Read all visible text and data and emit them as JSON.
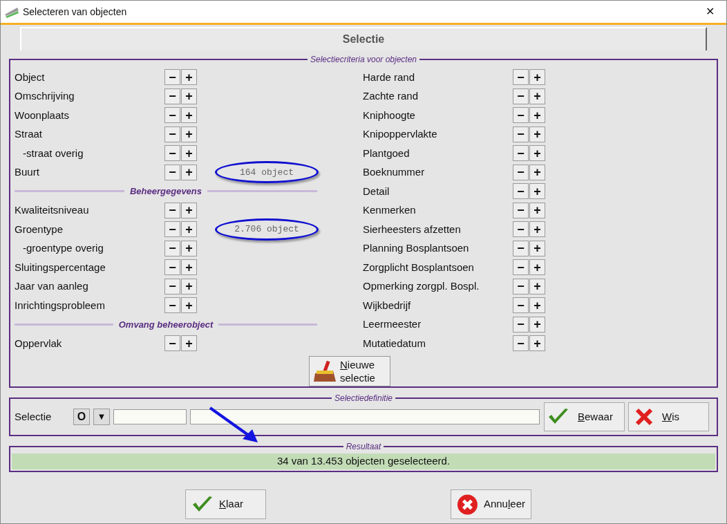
{
  "window": {
    "title": "Selecteren van objecten",
    "close": "✕"
  },
  "tab": {
    "label": "Selectie"
  },
  "criteria": {
    "legend": "Selectiecriteria voor objecten",
    "left": [
      {
        "kind": "row",
        "label": "Object",
        "indented": false
      },
      {
        "kind": "row",
        "label": "Omschrijving",
        "indented": false
      },
      {
        "kind": "row",
        "label": "Woonplaats",
        "indented": false
      },
      {
        "kind": "row",
        "label": "Straat",
        "indented": false
      },
      {
        "kind": "row",
        "label": "-straat overig",
        "indented": true
      },
      {
        "kind": "row",
        "label": "Buurt",
        "indented": false,
        "count": "164 object",
        "circled": true
      },
      {
        "kind": "divider",
        "label": "Beheergegevens"
      },
      {
        "kind": "row",
        "label": "Kwaliteitsniveau",
        "indented": false
      },
      {
        "kind": "row",
        "label": "Groentype",
        "indented": false,
        "count": "2.706 object",
        "circled": true
      },
      {
        "kind": "row",
        "label": "-groentype overig",
        "indented": true
      },
      {
        "kind": "row",
        "label": "Sluitingspercentage",
        "indented": false
      },
      {
        "kind": "row",
        "label": "Jaar van aanleg",
        "indented": false
      },
      {
        "kind": "row",
        "label": "Inrichtingsprobleem",
        "indented": false
      },
      {
        "kind": "divider",
        "label": "Omvang beheerobject"
      },
      {
        "kind": "row",
        "label": "Oppervlak",
        "indented": false
      }
    ],
    "right": [
      {
        "label": "Harde rand"
      },
      {
        "label": "Zachte rand"
      },
      {
        "label": "Kniphoogte"
      },
      {
        "label": "Knipoppervlakte"
      },
      {
        "label": "Plantgoed"
      },
      {
        "label": "Boeknummer"
      },
      {
        "label": "Detail"
      },
      {
        "label": "Kenmerken"
      },
      {
        "label": "Sierheesters afzetten"
      },
      {
        "label": "Planning Bosplantsoen"
      },
      {
        "label": "Zorgplicht Bosplantsoen"
      },
      {
        "label": "Opmerking zorgpl. Bospl."
      },
      {
        "label": "Wijkbedrijf"
      },
      {
        "label": "Leermeester"
      },
      {
        "label": "Mutatiedatum"
      }
    ],
    "minus": "−",
    "plus": "+",
    "new_selection": {
      "line1": {
        "key": "N",
        "post": "ieuwe"
      },
      "line2": "selectie"
    }
  },
  "definition": {
    "legend": "Selectiedefinitie",
    "label": "Selectie",
    "open_button": "O",
    "dropdown": "▼",
    "save": {
      "key": "B",
      "post": "ewaar"
    },
    "clear": {
      "key": "W",
      "post": "is"
    }
  },
  "result": {
    "legend": "Resultaat",
    "text": "34 van 13.453 objecten geselecteerd."
  },
  "buttons": [
    {
      "kind": "ok",
      "key": "K",
      "post": "laar"
    },
    {
      "kind": "cancel",
      "pre": "Annu",
      "key": "l",
      "post": "eer"
    }
  ]
}
